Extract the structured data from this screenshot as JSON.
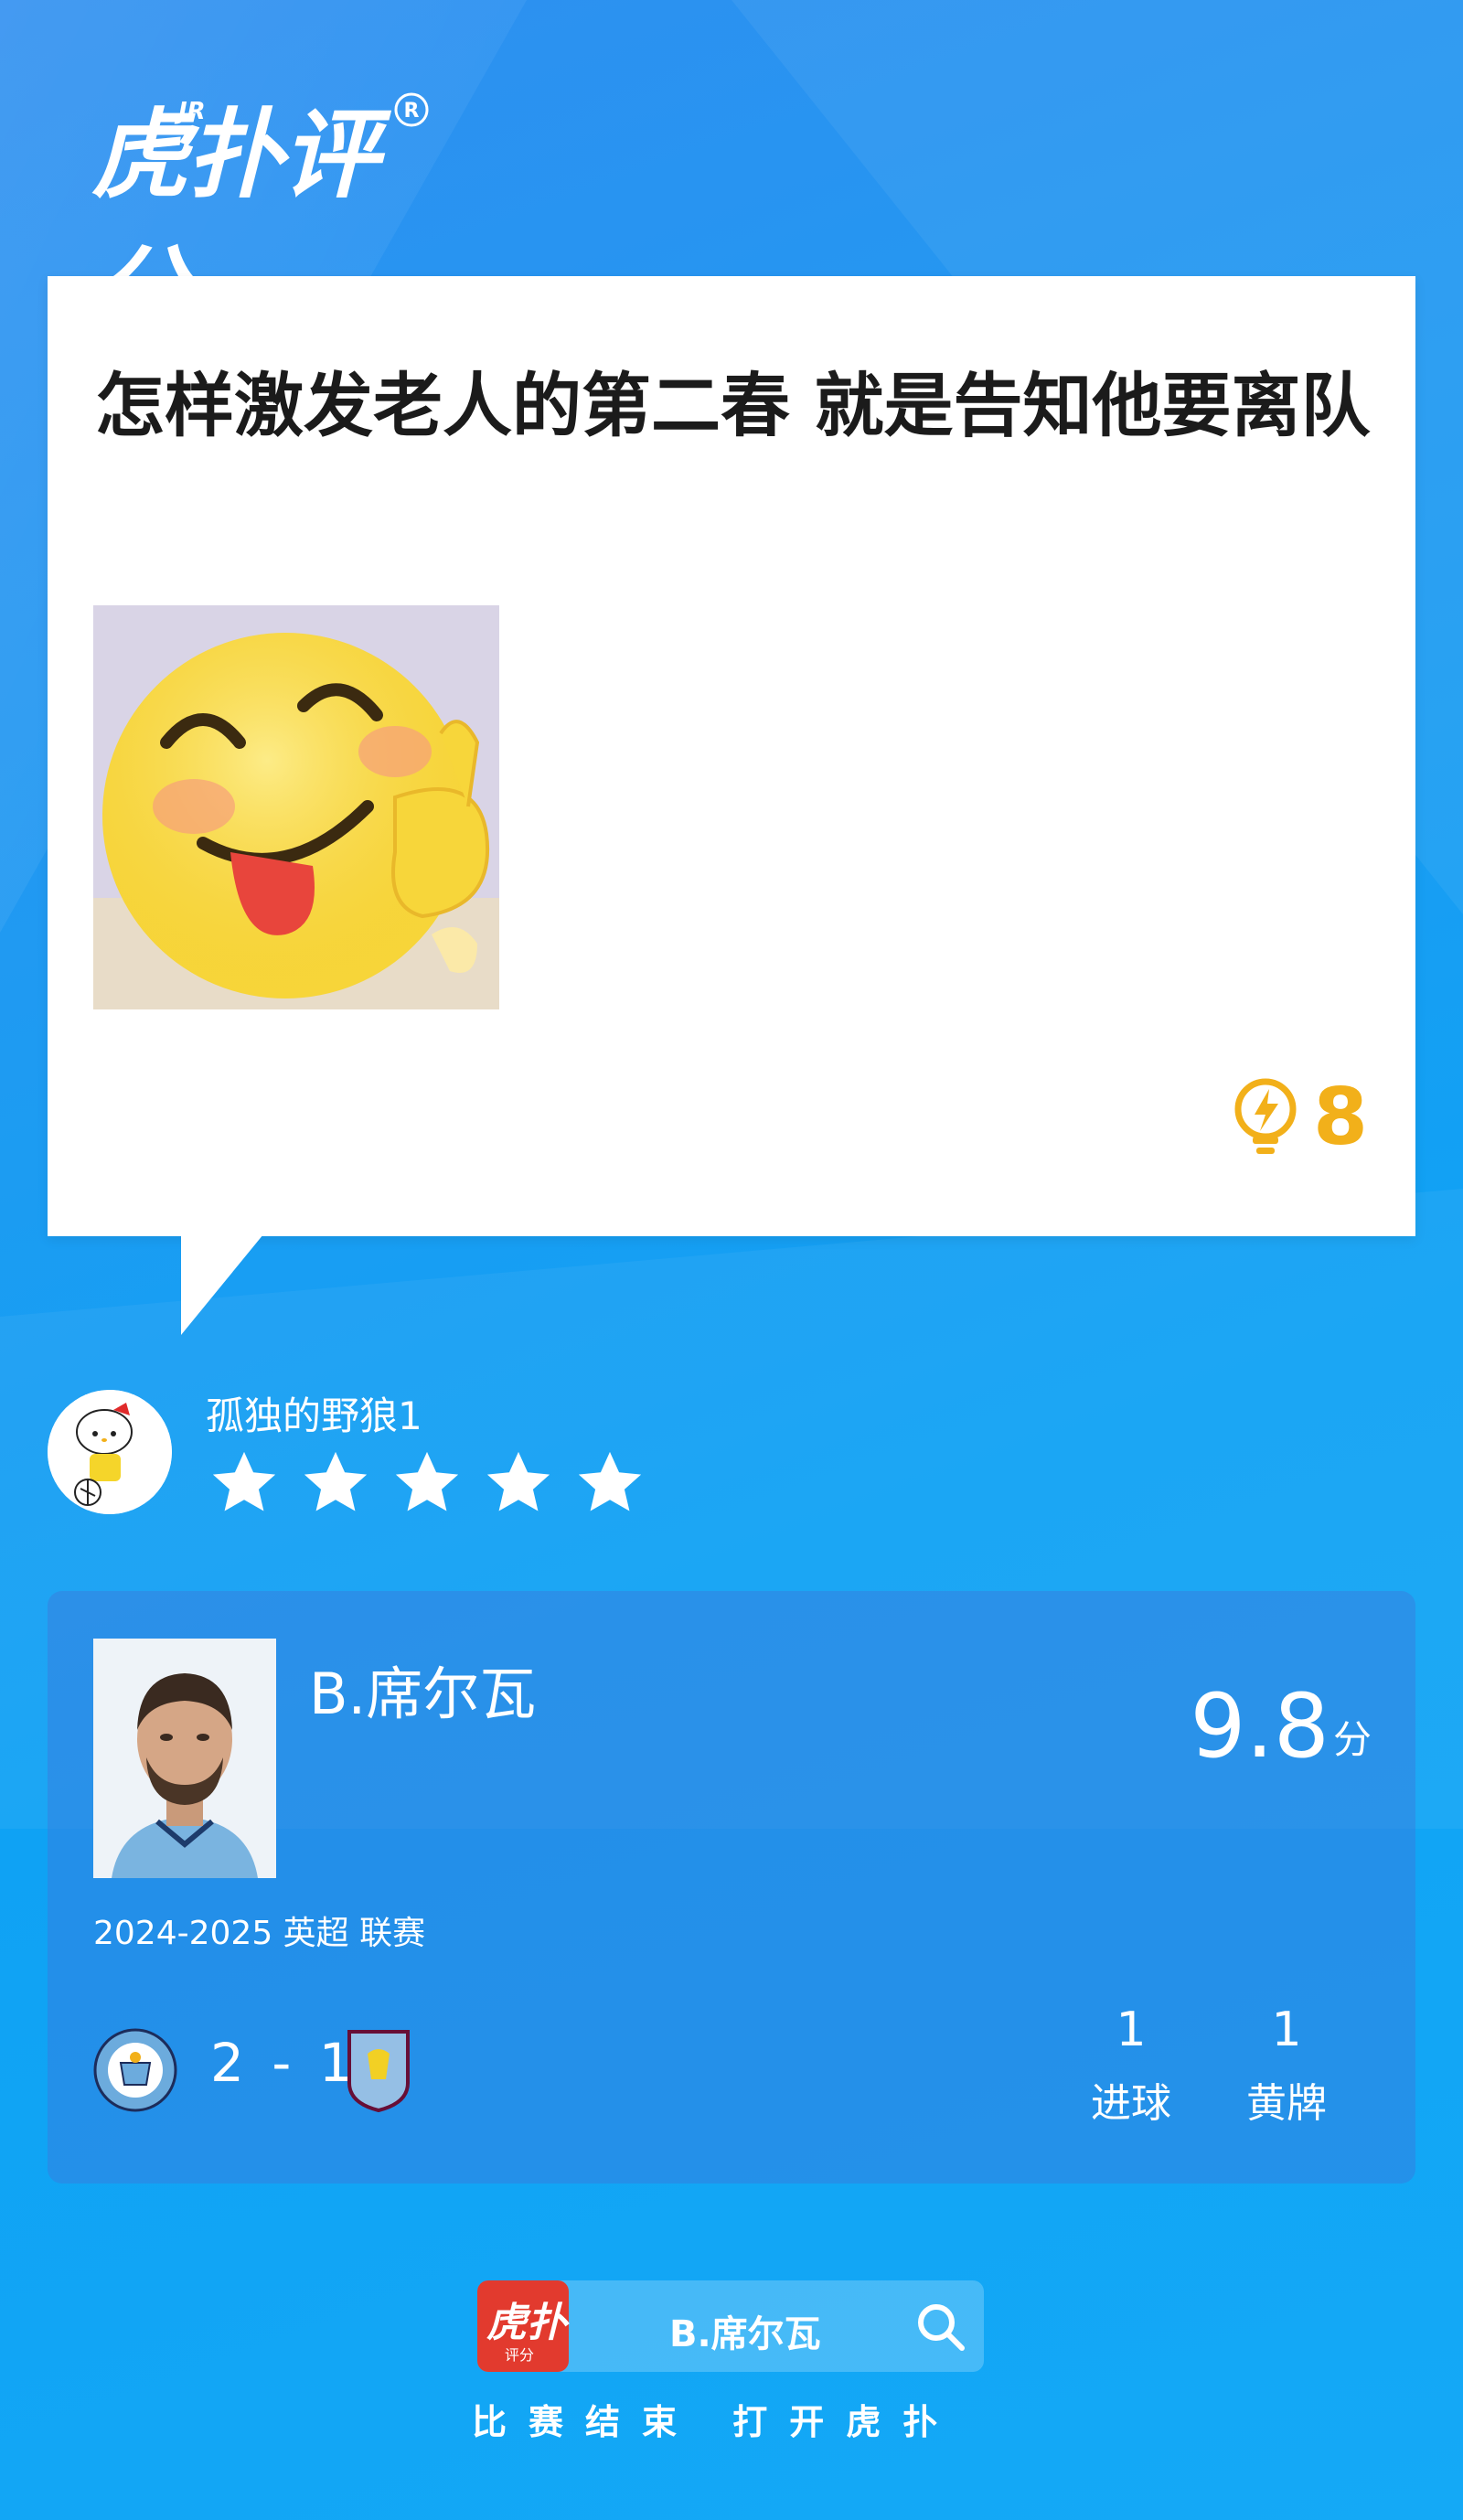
{
  "header": {
    "logo_text": "虎扑评分",
    "logo_superscript": "JR",
    "registered_mark": "®"
  },
  "comment": {
    "text": "怎样激发老人的第二春 就是告知他要离队",
    "likes": "8",
    "like_icon": "lightning-bulb-icon"
  },
  "reviewer": {
    "name": "孤独的野狼1",
    "rating_stars": 5
  },
  "player": {
    "name": "B.席尔瓦",
    "score_value": "9.8",
    "score_unit": "分",
    "season": "2024-2025 英超 联赛",
    "match_score": "2 - 1",
    "stats": [
      {
        "value": "1",
        "label": "进球"
      },
      {
        "value": "1",
        "label": "黄牌"
      }
    ]
  },
  "bottom_bar": {
    "app_icon_text": "虎扑",
    "app_icon_sub": "评分",
    "search_text": "B.席尔瓦",
    "tagline": "比赛结束 打开虎扑"
  },
  "colors": {
    "accent_yellow": "#f2b01a",
    "brand_red": "#e23a2e",
    "background_blue": "#1e9bf2"
  }
}
